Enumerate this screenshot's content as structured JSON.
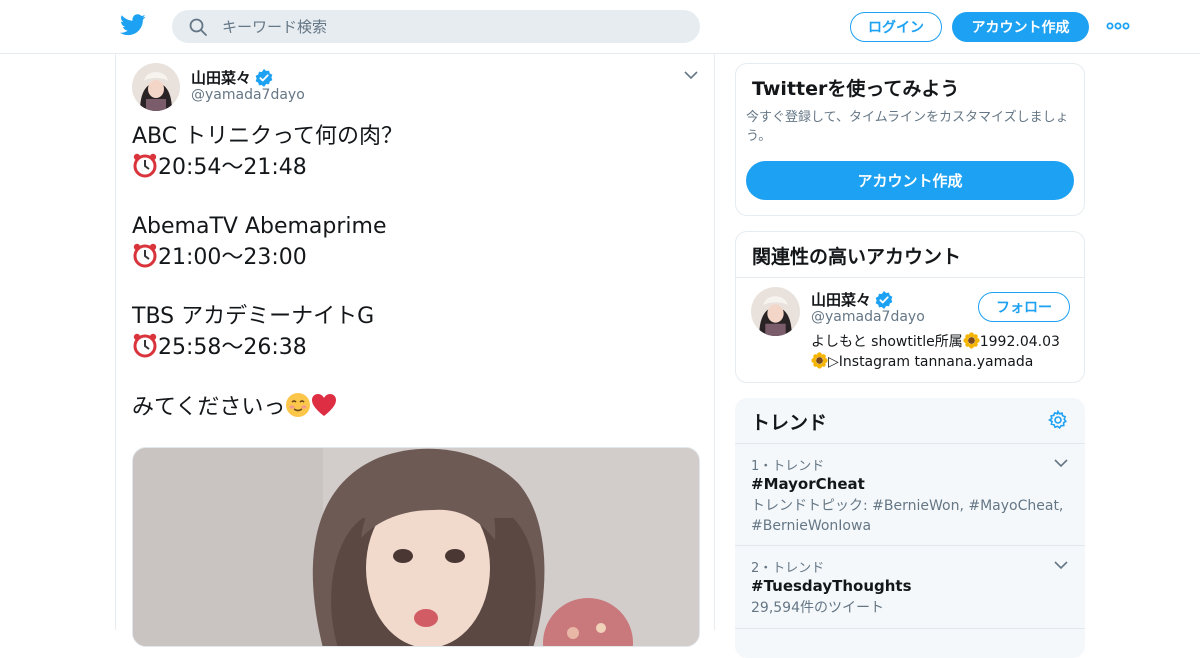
{
  "header": {
    "search_placeholder": "キーワード検索",
    "login_label": "ログイン",
    "signup_label": "アカウント作成",
    "logo_icon": "twitter-bird-icon",
    "more_icon": "more-dots-icon",
    "accent": "#1da1f2"
  },
  "tweet": {
    "author_name": "山田菜々",
    "author_handle": "@yamada7dayo",
    "lines": [
      "ABC トリニクって何の肉？",
      "20:54〜21:48",
      "AbemaTV Abemaprime",
      "21:00〜23:00",
      "TBS アカデミーナイトG",
      "25:58〜26:38",
      "みてくださいっ"
    ],
    "line_icons": {
      "alarm": "alarm-clock-icon",
      "smile": "smiling-face-icon",
      "heart": "red-heart-icon"
    }
  },
  "signup_card": {
    "title": "Twitterを使ってみよう",
    "description": "今すぐ登録して、タイムラインをカスタマイズしましょう。",
    "button_label": "アカウント作成"
  },
  "related_card": {
    "title": "関連性の高いアカウント",
    "account": {
      "name": "山田菜々",
      "handle": "@yamada7dayo",
      "follow_label": "フォロー",
      "bio_line1": "よしもと showtitle所属",
      "bio_line1_end": "1992.04.03",
      "bio_line2": "▷Instagram tannana.yamada"
    }
  },
  "trends_card": {
    "title": "トレンド",
    "items": [
      {
        "meta": "1・トレンド",
        "tag": "#MayorCheat",
        "sub": "トレンドトピック: #BernieWon, #MayoCheat, #BernieWonIowa"
      },
      {
        "meta": "2・トレンド",
        "tag": "#TuesdayThoughts",
        "sub": "29,594件のツイート"
      }
    ]
  }
}
